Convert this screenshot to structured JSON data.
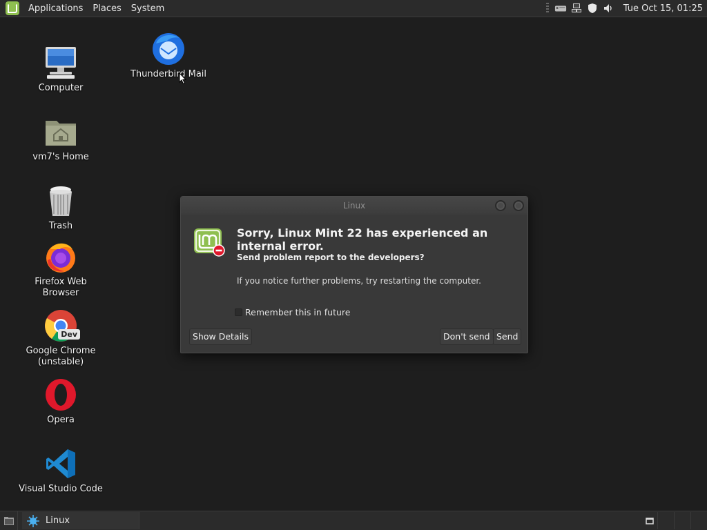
{
  "top_panel": {
    "menus": [
      "Applications",
      "Places",
      "System"
    ],
    "clock": "Tue Oct 15, 01:25"
  },
  "desktop": {
    "icons": [
      {
        "label": "Computer",
        "icon": "computer-icon"
      },
      {
        "label": "Thunderbird Mail",
        "icon": "thunderbird-icon"
      },
      {
        "label": "vm7's Home",
        "icon": "home-folder-icon"
      },
      {
        "label": "Trash",
        "icon": "trash-icon"
      },
      {
        "label": "Firefox Web Browser",
        "icon": "firefox-icon"
      },
      {
        "label": "Google Chrome",
        "label2": "(unstable)",
        "icon": "chrome-dev-icon",
        "badge": "Dev"
      },
      {
        "label": "Opera",
        "icon": "opera-icon"
      },
      {
        "label": "Visual Studio Code",
        "icon": "vscode-icon"
      }
    ]
  },
  "dialog": {
    "window_title": "Linux",
    "heading": "Sorry, Linux Mint 22 has experienced an internal error.",
    "question": "Send problem report to the developers?",
    "message": "If you notice further problems, try restarting the computer.",
    "remember_label": "Remember this in future",
    "remember_checked": false,
    "buttons": {
      "details": "Show Details",
      "dont_send": "Don't send",
      "send": "Send"
    }
  },
  "bottom_panel": {
    "task_label": "Linux"
  },
  "colors": {
    "desktop_bg": "#1e1e1e",
    "panel_bg": "#2b2b2b",
    "dialog_bg": "#393939",
    "mint_green": "#8fbf50",
    "error_red": "#e0182b"
  }
}
